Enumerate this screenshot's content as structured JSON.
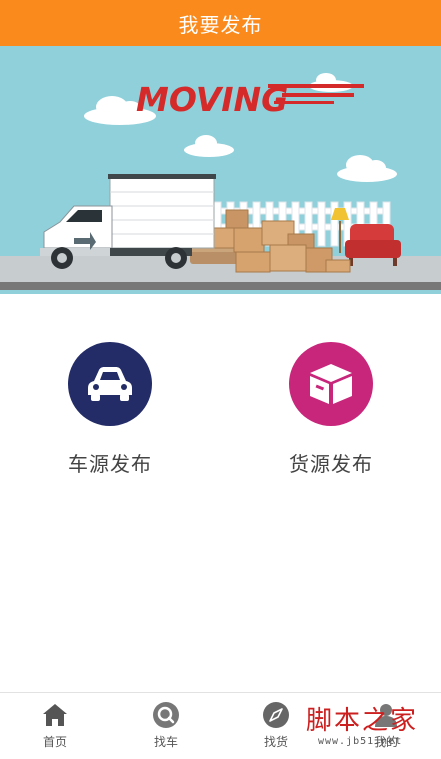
{
  "header": {
    "title": "我要发布"
  },
  "banner": {
    "logo_text": "MOVING"
  },
  "options": [
    {
      "label": "车源发布",
      "icon": "car-icon",
      "color": "#232c67"
    },
    {
      "label": "货源发布",
      "icon": "box-icon",
      "color": "#c8267b"
    }
  ],
  "tabbar": {
    "items": [
      {
        "label": "首页",
        "icon": "home-icon"
      },
      {
        "label": "找车",
        "icon": "search-car-icon"
      },
      {
        "label": "找货",
        "icon": "compass-icon"
      },
      {
        "label": "我的",
        "icon": "user-icon"
      }
    ]
  },
  "watermark": {
    "title": "脚本之家",
    "url": "www.jb51.net"
  },
  "colors": {
    "header_bg": "#fb8a1c",
    "sky": "#8fd0db",
    "road": "#777777"
  }
}
